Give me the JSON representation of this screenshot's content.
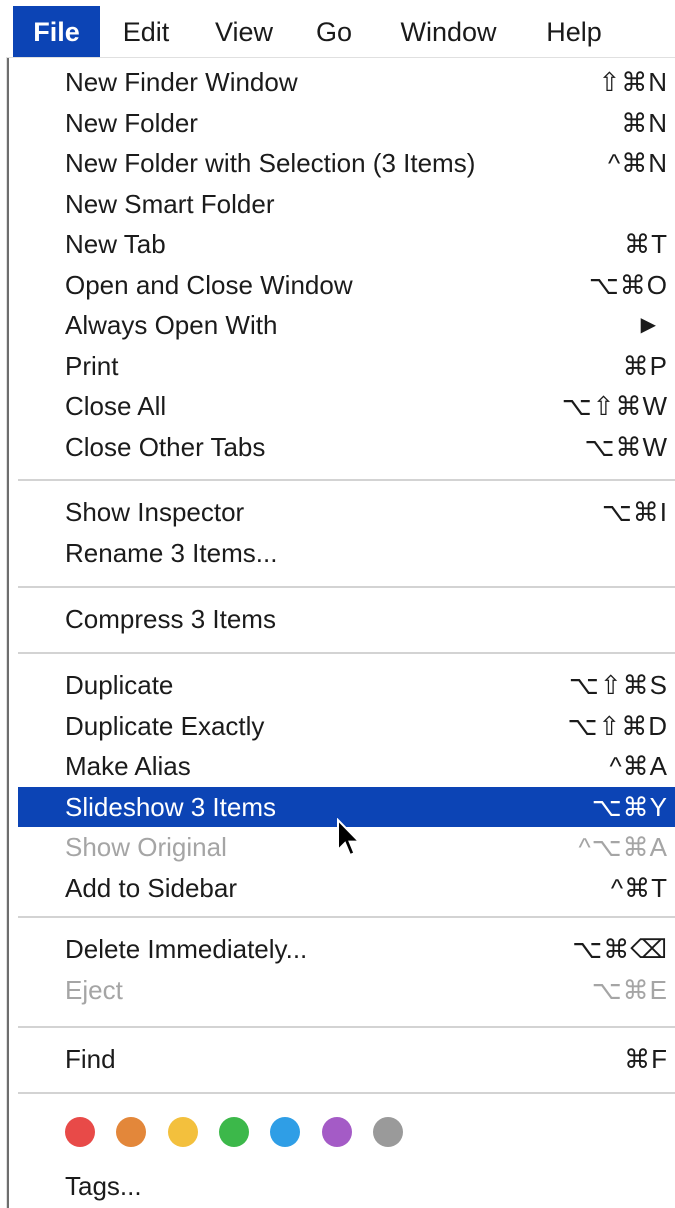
{
  "menubar": {
    "items": [
      {
        "label": "File",
        "active": true
      },
      {
        "label": "Edit"
      },
      {
        "label": "View"
      },
      {
        "label": "Go"
      },
      {
        "label": "Window"
      },
      {
        "label": "Help"
      }
    ]
  },
  "menu": {
    "groups": [
      [
        {
          "label": "New Finder Window",
          "shortcut": "⇧⌘N"
        },
        {
          "label": "New Folder",
          "shortcut": "⌘N"
        },
        {
          "label": "New Folder with Selection (3 Items)",
          "shortcut": "^⌘N"
        },
        {
          "label": "New Smart Folder",
          "shortcut": ""
        },
        {
          "label": "New Tab",
          "shortcut": "⌘T"
        },
        {
          "label": "Open and Close Window",
          "shortcut": "⌥⌘O"
        },
        {
          "label": "Always Open With",
          "shortcut": "▶"
        },
        {
          "label": "Print",
          "shortcut": "⌘P"
        },
        {
          "label": "Close All",
          "shortcut": "⌥⇧⌘W"
        },
        {
          "label": "Close Other Tabs",
          "shortcut": "⌥⌘W"
        }
      ],
      [
        {
          "label": "Show Inspector",
          "shortcut": "⌥⌘I"
        },
        {
          "label": "Rename 3 Items...",
          "shortcut": ""
        }
      ],
      [
        {
          "label": "Compress 3 Items",
          "shortcut": ""
        }
      ],
      [
        {
          "label": "Duplicate",
          "shortcut": "⌥⇧⌘S"
        },
        {
          "label": "Duplicate Exactly",
          "shortcut": "⌥⇧⌘D"
        },
        {
          "label": "Make Alias",
          "shortcut": "^⌘A"
        },
        {
          "label": "Slideshow 3 Items",
          "shortcut": "⌥⌘Y",
          "highlighted": true
        },
        {
          "label": "Show Original",
          "shortcut": "^⌥⌘A",
          "disabled": true
        },
        {
          "label": "Add to Sidebar",
          "shortcut": "^⌘T"
        }
      ],
      [
        {
          "label": "Delete Immediately...",
          "shortcut": "⌥⌘⌫"
        },
        {
          "label": "Eject",
          "shortcut": "⌥⌘E",
          "disabled": true
        }
      ],
      [
        {
          "label": "Find",
          "shortcut": "⌘F"
        }
      ]
    ],
    "tags": {
      "colors": [
        "#e84a48",
        "#e3873a",
        "#f3c03d",
        "#3cb84a",
        "#2f9ee6",
        "#a45bc6",
        "#9a9a9a"
      ],
      "label": "Tags..."
    }
  },
  "colors": {
    "highlight": "#0c44b5",
    "disabled_text": "#a5a5a5"
  }
}
